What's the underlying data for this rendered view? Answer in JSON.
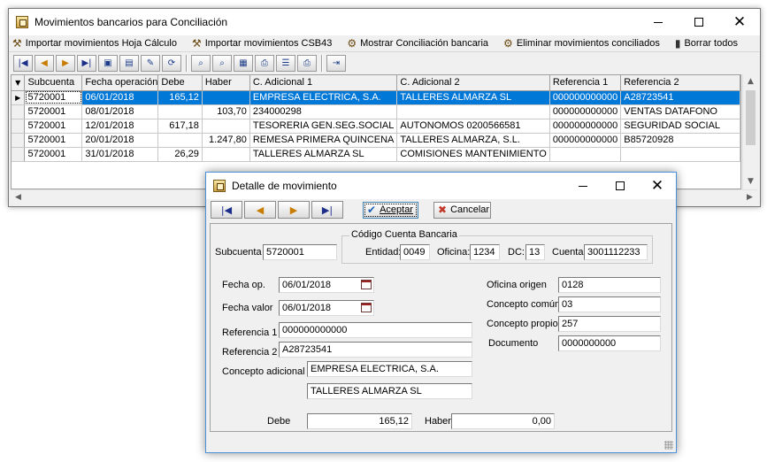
{
  "main": {
    "title": "Movimientos bancarios para Conciliación",
    "menu": [
      {
        "label": "Importar movimientos Hoja Cálculo",
        "icon": "import-sheet-icon"
      },
      {
        "label": "Importar movimientos CSB43",
        "icon": "import-csb43-icon"
      },
      {
        "label": "Mostrar Conciliación bancaria",
        "icon": "show-reconciliation-icon"
      },
      {
        "label": "Eliminar movimientos conciliados",
        "icon": "delete-reconciled-icon"
      },
      {
        "label": "Borrar todos",
        "icon": "trash-icon"
      }
    ],
    "toolbar_icons": [
      "first-record-icon",
      "previous-record-icon",
      "next-record-icon",
      "last-record-icon",
      "insert-record-icon",
      "delete-record-icon",
      "edit-record-icon",
      "refresh-icon",
      "search-icon",
      "search-next-icon",
      "filter-icon",
      "print-icon",
      "list-icon",
      "print-preview-icon",
      "export-icon"
    ],
    "grid": {
      "columns": [
        "Subcuenta",
        "Fecha operación",
        "Debe",
        "Haber",
        "C. Adicional 1",
        "C. Adicional 2",
        "Referencia 1",
        "Referencia 2"
      ],
      "rows": [
        [
          "5720001",
          "06/01/2018",
          "165,12",
          "",
          "EMPRESA ELECTRICA, S.A.",
          "TALLERES ALMARZA SL",
          "000000000000",
          "A28723541"
        ],
        [
          "5720001",
          "08/01/2018",
          "",
          "103,70",
          "234000298",
          "",
          "000000000000",
          "VENTAS DATAFONO"
        ],
        [
          "5720001",
          "12/01/2018",
          "617,18",
          "",
          "TESORERIA GEN.SEG.SOCIAL",
          "AUTONOMOS 0200566581",
          "000000000000",
          "SEGURIDAD SOCIAL"
        ],
        [
          "5720001",
          "20/01/2018",
          "",
          "1.247,80",
          "REMESA PRIMERA QUINCENA",
          "TALLERES ALMARZA, S.L.",
          "000000000000",
          "B85720928"
        ],
        [
          "5720001",
          "31/01/2018",
          "26,29",
          "",
          "TALLERES ALMARZA SL",
          "COMISIONES MANTENIMIENTO",
          "",
          ""
        ]
      ]
    }
  },
  "dialog": {
    "title": "Detalle de movimiento",
    "accept_label": "Aceptar",
    "cancel_label": "Cancelar",
    "subcuenta_label": "Subcuenta",
    "subcuenta_value": "5720001",
    "ccc_title": "Código Cuenta Bancaria",
    "entidad_label": "Entidad:",
    "entidad_value": "0049",
    "oficina_label": "Oficina:",
    "oficina_value": "1234",
    "dc_label": "DC:",
    "dc_value": "13",
    "cuenta_label": "Cuenta:",
    "cuenta_value": "3001112233",
    "fecha_op_label": "Fecha op.",
    "fecha_op_value": "06/01/2018",
    "fecha_valor_label": "Fecha valor",
    "fecha_valor_value": "06/01/2018",
    "referencia1_label": "Referencia 1",
    "referencia1_value": "000000000000",
    "referencia2_label": "Referencia 2",
    "referencia2_value": "A28723541",
    "concepto_adicional_label": "Concepto adicional",
    "concepto_adicional1_value": "EMPRESA ELECTRICA, S.A.",
    "concepto_adicional2_value": "TALLERES ALMARZA SL",
    "oficina_origen_label": "Oficina origen",
    "oficina_origen_value": "0128",
    "concepto_comun_label": "Concepto común",
    "concepto_comun_value": "03",
    "concepto_propio_label": "Concepto propio",
    "concepto_propio_value": "257",
    "documento_label": "Documento",
    "documento_value": "0000000000",
    "debe_label": "Debe",
    "debe_value": "165,12",
    "haber_label": "Haber",
    "haber_value": "0,00"
  }
}
